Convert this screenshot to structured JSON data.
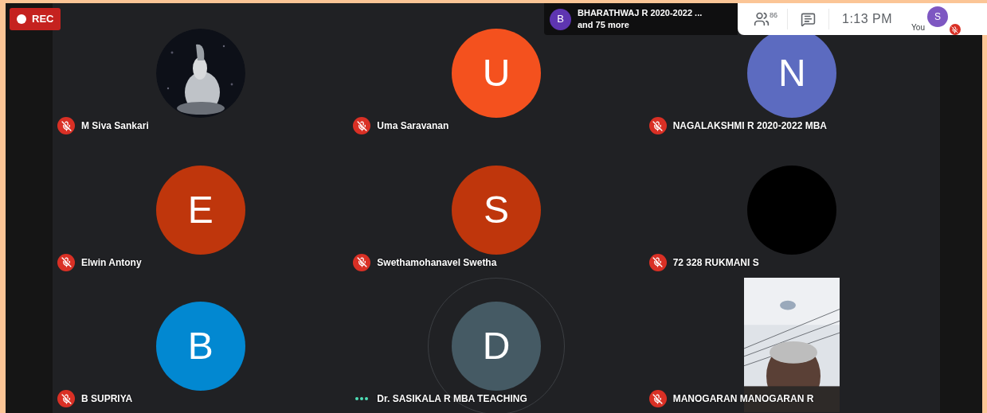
{
  "recording": {
    "label": "REC"
  },
  "presenter_banner": {
    "avatar_letter": "B",
    "color": "#5e35b1",
    "title": "BHARATHWAJ R 2020-2022 ...",
    "subtitle": "and 75 more"
  },
  "toolbar": {
    "participant_count": "86",
    "time": "1:13 PM",
    "self": {
      "avatar_letter": "S",
      "color": "#7e57c2",
      "label": "You",
      "muted": true
    }
  },
  "tiles": [
    {
      "kind": "picture",
      "name": "M Siva Sankari",
      "muted": true
    },
    {
      "kind": "letter",
      "letter": "U",
      "color": "#f4511e",
      "name": "Uma Saravanan",
      "muted": true
    },
    {
      "kind": "letter",
      "letter": "N",
      "color": "#5c6bc0",
      "name": "NAGALAKSHMI R 2020-2022 MBA",
      "muted": true
    },
    {
      "kind": "letter",
      "letter": "E",
      "color": "#bf360c",
      "name": "Elwin Antony",
      "muted": true
    },
    {
      "kind": "letter",
      "letter": "S",
      "color": "#bf360c",
      "name": "Swethamohanavel Swetha",
      "muted": true
    },
    {
      "kind": "blank",
      "color": "#000000",
      "name": "72 328 RUKMANI S",
      "muted": true
    },
    {
      "kind": "letter",
      "letter": "B",
      "color": "#0288d1",
      "name": "B SUPRIYA",
      "muted": true
    },
    {
      "kind": "letter",
      "letter": "D",
      "color": "#455a64",
      "name": "Dr. SASIKALA R MBA TEACHING",
      "muted": false
    },
    {
      "kind": "video",
      "name": "MANOGARAN MANOGARAN R",
      "muted": true
    }
  ]
}
